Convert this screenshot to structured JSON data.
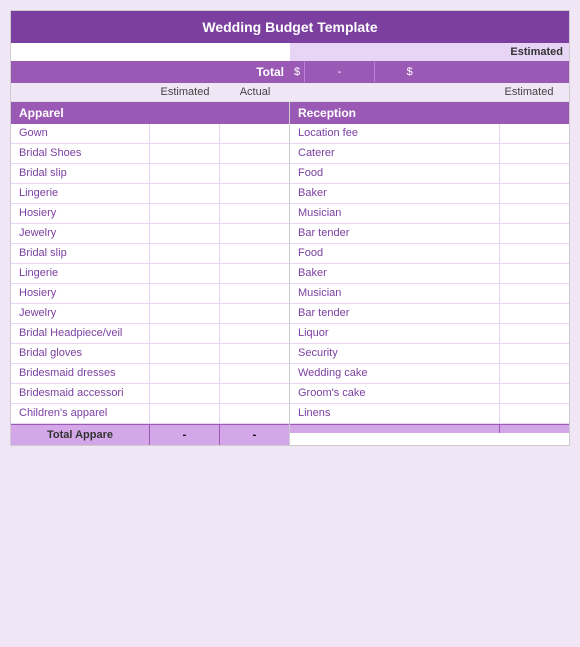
{
  "title": "Wedding Budget Template",
  "estimatedLabel": "Estimated",
  "totalLabel": "Total",
  "dollarSign": "$",
  "dash": "-",
  "leftSection": {
    "header": "Apparel",
    "colHeaders": [
      "Estimated",
      "Actual"
    ],
    "items": [
      "Gown",
      "Bridal Shoes",
      "Bridal slip",
      "Lingerie",
      "Hosiery",
      "Jewelry",
      "Bridal slip",
      "Lingerie",
      "Hosiery",
      "Jewelry",
      "Bridal Headpiece/veil",
      "Bridal gloves",
      "Bridesmaid dresses",
      "Bridesmaid accessori",
      "Children's apparel"
    ],
    "footerLabel": "Total Appare",
    "footerValues": [
      "-",
      "-"
    ]
  },
  "rightSection": {
    "header": "Reception",
    "colHeader": "Estimated",
    "items": [
      "Location fee",
      "Caterer",
      "Food",
      "Baker",
      "Musician",
      "Bar tender",
      "Food",
      "Baker",
      "Musician",
      "Bar tender",
      "Liquor",
      "Security",
      "Wedding cake",
      "Groom's cake",
      "Linens"
    ]
  }
}
